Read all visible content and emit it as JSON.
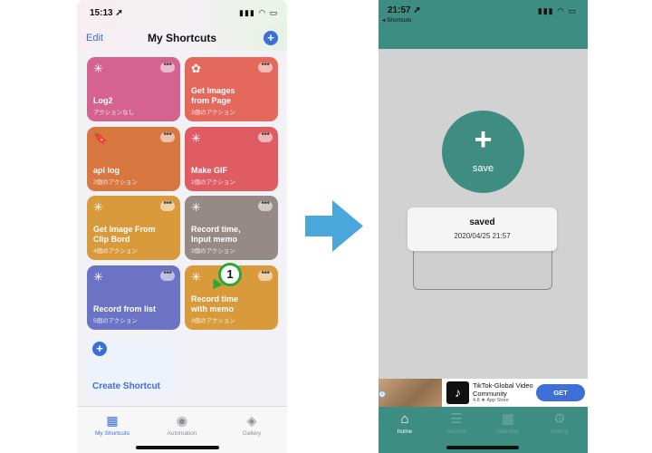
{
  "left_phone": {
    "status": {
      "time": "15:13 ➚",
      "indicators": "▮▮▮ ◠ ▭"
    },
    "header": {
      "edit": "Edit",
      "title": "My Shortcuts",
      "add": "+"
    },
    "cards": [
      {
        "title": "Log2",
        "sub": "アクションなし",
        "icon": "✳",
        "color": "#d4648f"
      },
      {
        "title": "Get Images from Page",
        "sub": "3個のアクション",
        "icon": "✿",
        "color": "#e4685c"
      },
      {
        "title": "api log",
        "sub": "2個のアクション",
        "icon": "🔖",
        "color": "#d8773f"
      },
      {
        "title": "Make GIF",
        "sub": "1個のアクション",
        "icon": "✳",
        "color": "#df5c62"
      },
      {
        "title": "Get Image From Clip Bord",
        "sub": "4個のアクション",
        "icon": "✳",
        "color": "#d99a3c"
      },
      {
        "title": "Record time, Input memo",
        "sub": "3個のアクション",
        "icon": "✳",
        "color": "#958a85"
      },
      {
        "title": "Record from list",
        "sub": "5個のアクション",
        "icon": "✳",
        "color": "#6c73c4"
      },
      {
        "title": "Record time with memo",
        "sub": "3個のアクション",
        "icon": "✳",
        "color": "#d99a3c"
      }
    ],
    "more": "•••",
    "create": {
      "plus": "+",
      "label": "Create Shortcut"
    },
    "badge": "1",
    "tabs": [
      {
        "label": "My Shortcuts",
        "icon": "▦"
      },
      {
        "label": "Automation",
        "icon": "◉"
      },
      {
        "label": "Gallery",
        "icon": "◈"
      }
    ]
  },
  "right_phone": {
    "status": {
      "time": "21:57 ➚",
      "back": "◂ Shortcuts",
      "indicators": "▮▮▮ ◠ ▭"
    },
    "save_button": {
      "plus": "+",
      "label": "save"
    },
    "toast": {
      "title": "saved",
      "datetime": "2020/04/25 21:57"
    },
    "ad": {
      "title": "TikTok-Global Video Community",
      "rating": "4.8 ★ App Store",
      "cta": "GET",
      "logo": "♪",
      "info": "i"
    },
    "tabs": [
      {
        "label": "home",
        "icon": "⌂"
      },
      {
        "label": "records",
        "icon": "☰"
      },
      {
        "label": "calendar",
        "icon": "▦"
      },
      {
        "label": "setting",
        "icon": "⚙"
      }
    ]
  },
  "colors": {
    "accent_blue": "#3a6fd8",
    "teal": "#3d8d82",
    "arrow": "#4aa7dc",
    "badge_green": "#2aa836"
  }
}
